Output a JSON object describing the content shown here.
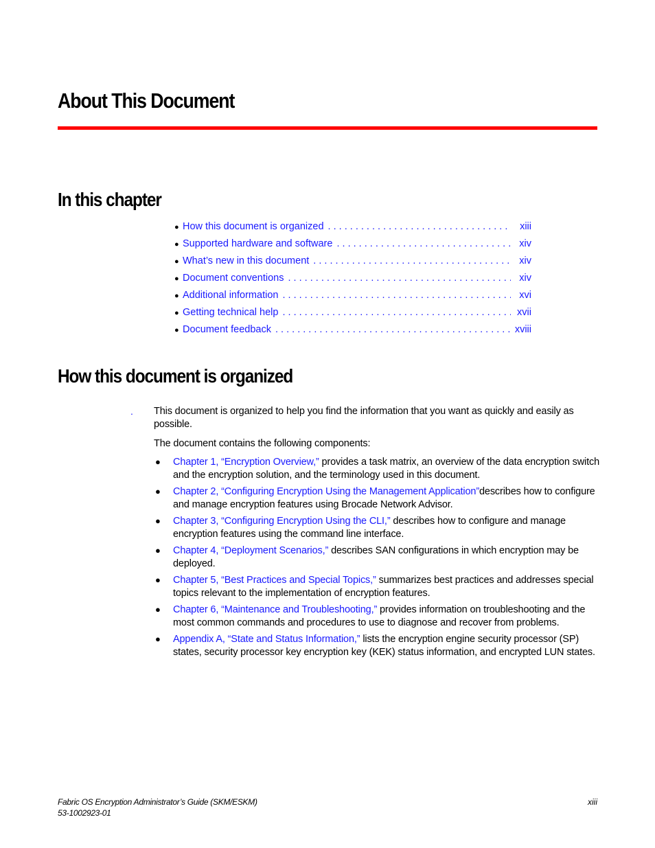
{
  "page": {
    "title": "About This Document",
    "accent_color": "#ff0000",
    "link_color": "#1a1aff"
  },
  "in_this_chapter": {
    "heading": "In this chapter",
    "items": [
      {
        "label": "How this document is organized",
        "page": "xiii"
      },
      {
        "label": "Supported hardware and software",
        "page": "xiv"
      },
      {
        "label": "What’s new in this document",
        "page": "xiv"
      },
      {
        "label": "Document conventions",
        "page": "xiv"
      },
      {
        "label": "Additional information",
        "page": "xvi"
      },
      {
        "label": "Getting technical help",
        "page": "xvii"
      },
      {
        "label": "Document feedback",
        "page": "xviii"
      }
    ]
  },
  "how_organized": {
    "heading": "How this document is organized",
    "marker": ".",
    "intro": "This document is organized to help you find the information that you want as quickly and easily as possible.",
    "components_intro": "The document contains the following components:",
    "components": [
      {
        "link": "Chapter 1, “Encryption Overview,”",
        "text": " provides a task matrix, an overview of the data encryption switch and the encryption solution, and the terminology used in this document."
      },
      {
        "link": "Chapter 2, “Configuring Encryption Using the Management Application”",
        "text": "describes how to configure and manage encryption features using Brocade Network Advisor."
      },
      {
        "link": "Chapter 3, “Configuring Encryption Using the CLI,”",
        "text": " describes how to configure and manage encryption features using the command line interface."
      },
      {
        "link": "Chapter 4, “Deployment Scenarios,”",
        "text": " describes SAN configurations in which encryption may be deployed."
      },
      {
        "link": "Chapter 5, “Best Practices and Special Topics,”",
        "text": " summarizes best practices and addresses special topics relevant to the implementation of encryption features."
      },
      {
        "link": "Chapter 6, “Maintenance and Troubleshooting,”",
        "text": " provides information on troubleshooting and the most common commands and procedures to use to diagnose and recover from problems."
      },
      {
        "link": "Appendix A, “State and Status Information,”",
        "text": " lists the encryption engine security processor (SP) states, security processor key encryption key (KEK) status information, and encrypted LUN states."
      }
    ]
  },
  "footer": {
    "doc_title": "Fabric OS Encryption Administrator’s Guide (SKM/ESKM)",
    "doc_number": "53-1002923-01",
    "page_number": "xiii"
  }
}
